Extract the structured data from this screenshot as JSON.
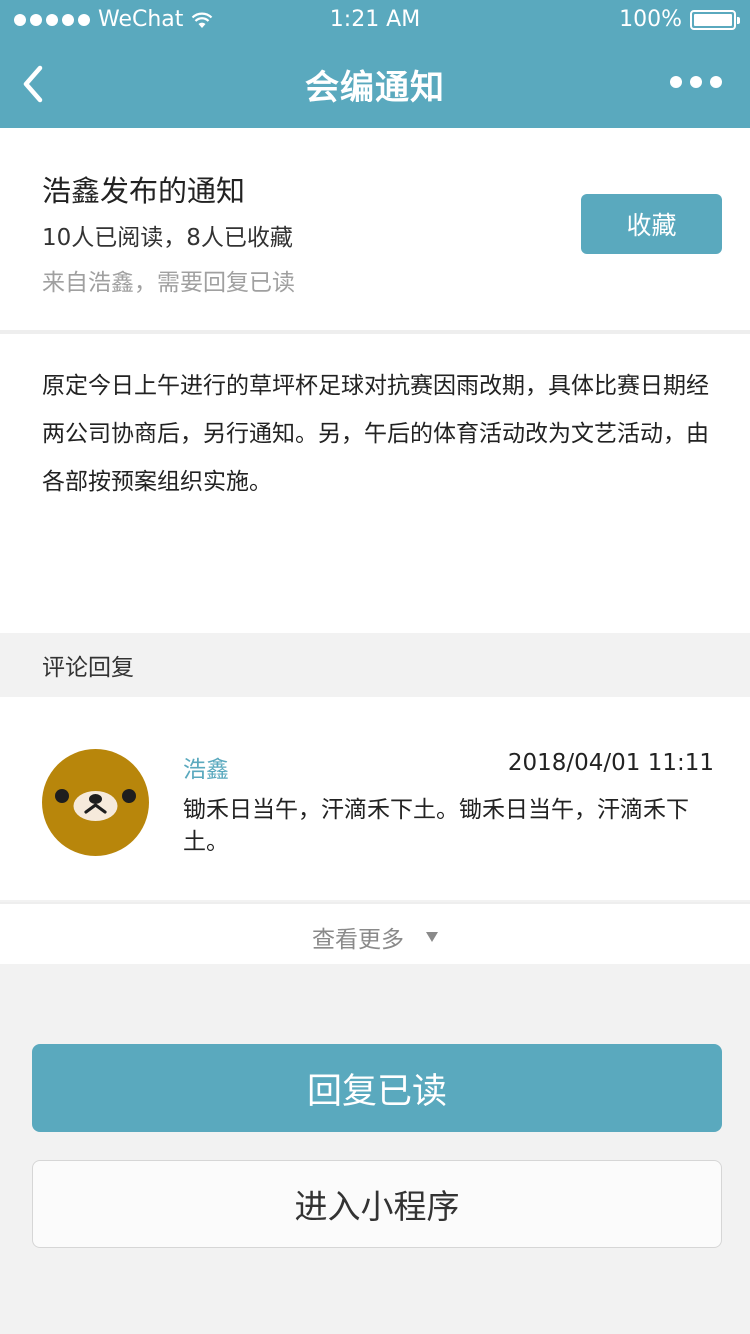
{
  "status_bar": {
    "carrier": "WeChat",
    "time": "1:21 AM",
    "battery": "100%"
  },
  "nav": {
    "title": "会编通知"
  },
  "notice": {
    "title": "浩鑫发布的通知",
    "stats": "10人已阅读，8人已收藏",
    "source": "来自浩鑫，需要回复已读",
    "favorite_label": "收藏"
  },
  "content": {
    "body": "原定今日上午进行的草坪杯足球对抗赛因雨改期，具体比赛日期经两公司协商后，另行通知。另，午后的体育活动改为文艺活动，由各部按预案组织实施。"
  },
  "comments": {
    "section_label": "评论回复",
    "items": [
      {
        "author": "浩鑫",
        "time": "2018/04/01 11:11",
        "text": "锄禾日当午，汗滴禾下土。锄禾日当午，汗滴禾下土。"
      }
    ],
    "more_label": "查看更多"
  },
  "actions": {
    "reply_label": "回复已读",
    "mini_program_label": "进入小程序"
  },
  "colors": {
    "accent": "#5aa9be",
    "background": "#f2f2f2",
    "avatar": "#b8860b"
  }
}
